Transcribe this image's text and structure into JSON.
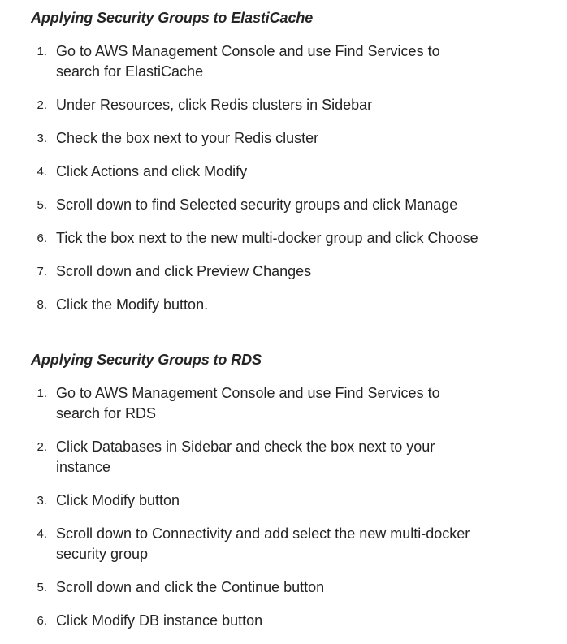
{
  "sections": [
    {
      "heading": "Applying Security Groups to ElastiCache",
      "steps": [
        {
          "num": "1.",
          "text": "Go to AWS Management Console and use Find Services to search for ElastiCache"
        },
        {
          "num": "2.",
          "text": "Under Resources, click Redis clusters in Sidebar"
        },
        {
          "num": "3.",
          "text": "Check the box next to your Redis cluster"
        },
        {
          "num": "4.",
          "text": "Click Actions and click Modify"
        },
        {
          "num": "5.",
          "text": "Scroll down to find Selected security groups and click Manage"
        },
        {
          "num": "6.",
          "text": "Tick the box next to the new multi-docker group and click Choose"
        },
        {
          "num": "7.",
          "text": "Scroll down and click Preview Changes"
        },
        {
          "num": "8.",
          "text": "Click the Modify button."
        }
      ]
    },
    {
      "heading": "Applying Security Groups to RDS",
      "steps": [
        {
          "num": "1.",
          "text": "Go to AWS Management Console and use Find Services to search for RDS"
        },
        {
          "num": "2.",
          "text": "Click Databases in Sidebar and check the box next to your instance"
        },
        {
          "num": "3.",
          "text": "Click Modify button"
        },
        {
          "num": "4.",
          "text": "Scroll down to Connectivity and add select the new multi-docker security group"
        },
        {
          "num": "5.",
          "text": "Scroll down and click the Continue button"
        },
        {
          "num": "6.",
          "text": "Click Modify DB instance button"
        }
      ]
    }
  ]
}
